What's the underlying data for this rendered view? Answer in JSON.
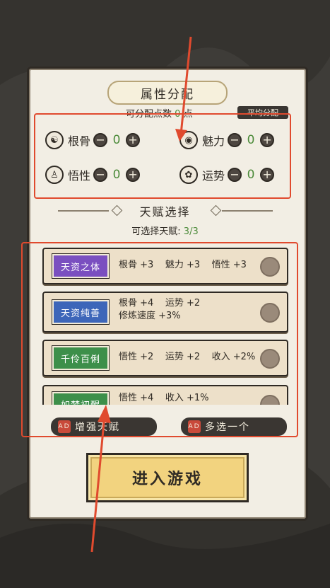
{
  "header": {
    "title": "属性分配",
    "points_prefix": "可分配点数",
    "points_value": "0",
    "points_suffix": "点",
    "avg_button": "平均分配"
  },
  "attributes": [
    {
      "name": "根骨",
      "value": "0",
      "icon": "skeleton-icon"
    },
    {
      "name": "魅力",
      "value": "0",
      "icon": "eye-icon"
    },
    {
      "name": "悟性",
      "value": "0",
      "icon": "meditation-icon"
    },
    {
      "name": "运势",
      "value": "0",
      "icon": "clover-icon"
    }
  ],
  "talents": {
    "title": "天赋选择",
    "count_label": "可选择天赋:",
    "count_value": "3/3",
    "items": [
      {
        "name": "天资之体",
        "desc": "根骨 +3    魅力 +3    悟性 +3",
        "color": "#7a4fc0"
      },
      {
        "name": "天资纯善",
        "desc": "根骨 +4    运势 +2\n修炼速度 +3%",
        "color": "#3d66b9"
      },
      {
        "name": "千伶百俐",
        "desc": "悟性 +2    运势 +2    收入 +2%",
        "color": "#3d8f4a"
      },
      {
        "name": "如梦初醒",
        "desc": "悟性 +4    收入 +1%",
        "color": "#3d8f4a"
      }
    ]
  },
  "actions": {
    "enhance": "增强天赋",
    "multi": "多选一个"
  },
  "enter_button": "进入游戏",
  "colors": {
    "accent_green": "#4c8b3a",
    "highlight": "#e04a2e",
    "gold": "#f2d37f"
  }
}
